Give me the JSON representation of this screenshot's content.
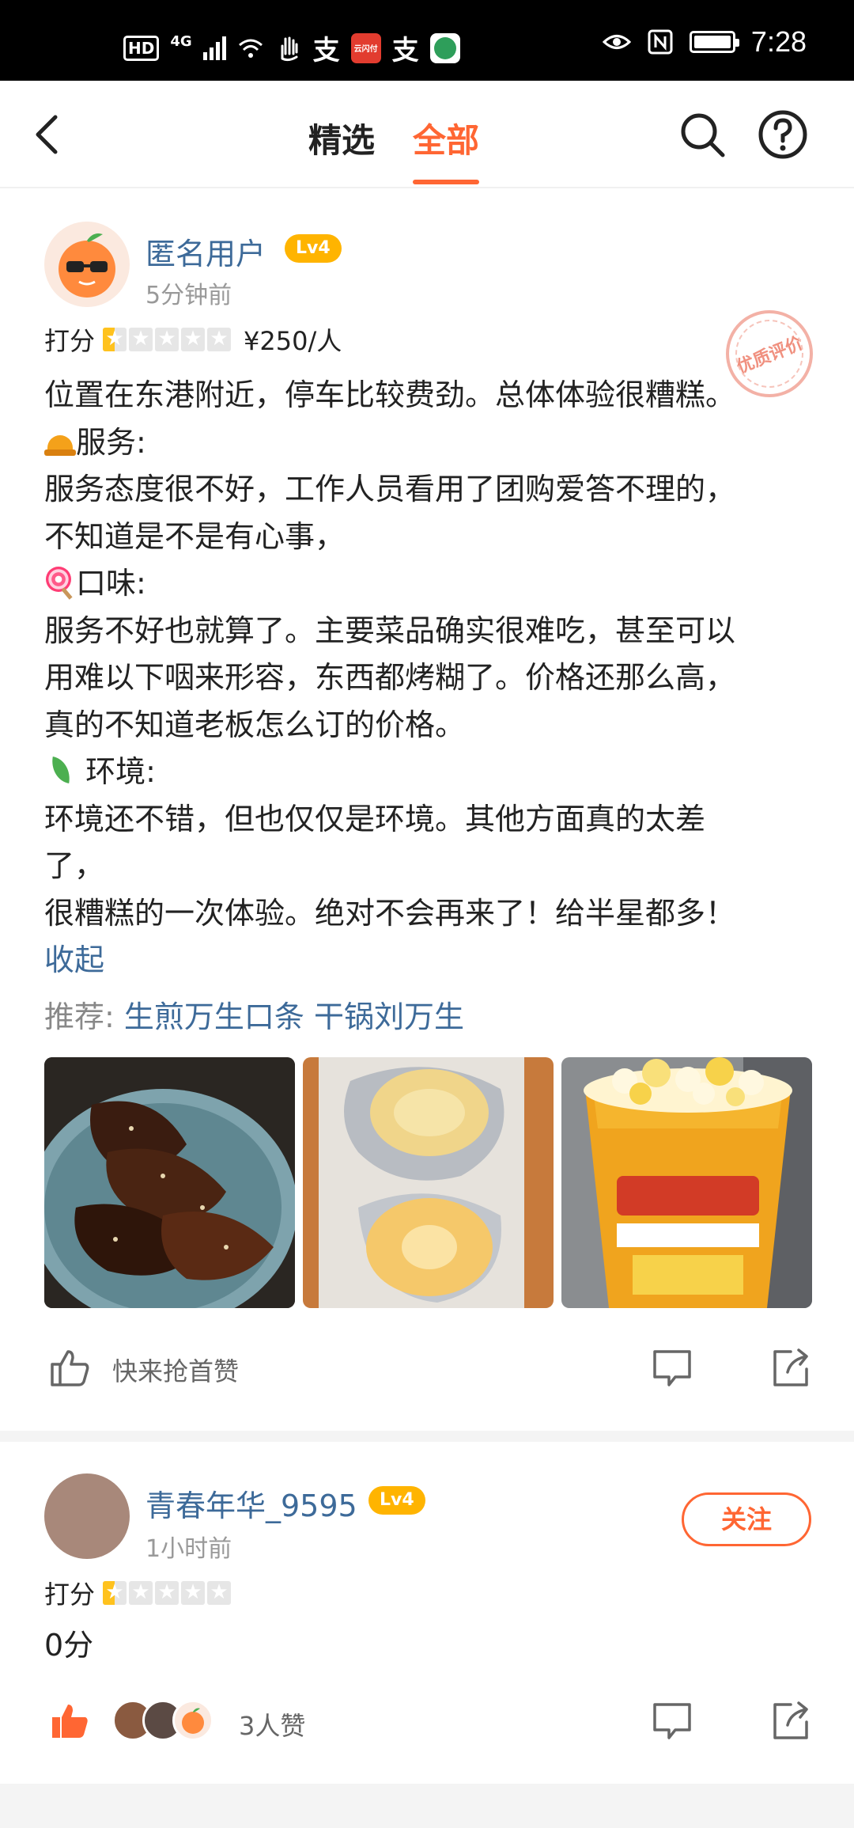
{
  "status_bar": {
    "hd": "HD",
    "network": "4G",
    "app_label": "云闪付",
    "alipay_1": "支",
    "alipay_2": "支",
    "time": "7:28"
  },
  "header": {
    "tab_featured": "精选",
    "tab_all": "全部",
    "active_tab": "全部"
  },
  "review1": {
    "username": "匿名用户",
    "level": "Lv4",
    "time": "5分钟前",
    "score_label": "打分",
    "rating": 0.5,
    "price": "¥250/人",
    "stamp": "优质评价",
    "lines": {
      "l1": "位置在东港附近，停车比较费劲。总体体验很糟糕。",
      "l2": "服务:",
      "l3": "服务态度很不好，工作人员看用了团购爱答不理的，",
      "l4": "不知道是不是有心事，",
      "l5": "口味:",
      "l6": "服务不好也就算了。主要菜品确实很难吃，甚至可以",
      "l7": "用难以下咽来形容，东西都烤糊了。价格还那么高，",
      "l8": "真的不知道老板怎么订的价格。",
      "l9": "环境:",
      "l10": "环境还不错，但也仅仅是环境。其他方面真的太差",
      "l11": "了，",
      "l12": "很糟糕的一次体验。绝对不会再来了！给半星都多！"
    },
    "collapse": "收起",
    "recommend_label": "推荐:",
    "recommend_dishes": "生煎万生口条 干锅刘万生",
    "like_prompt": "快来抢首赞",
    "photo_icons": [
      "grilled-shrimp-photo",
      "scallop-photo",
      "popcorn-photo"
    ]
  },
  "review2": {
    "username": "青春年华_9595",
    "level": "Lv4",
    "time": "1小时前",
    "follow": "关注",
    "score_label": "打分",
    "rating": 0.5,
    "score_text": "0分",
    "likes": "3人赞"
  },
  "colors": {
    "accent": "#ff6633",
    "link": "#3d6a99",
    "level_badge": "#ffb400",
    "star_filled": "#ffc21e"
  }
}
